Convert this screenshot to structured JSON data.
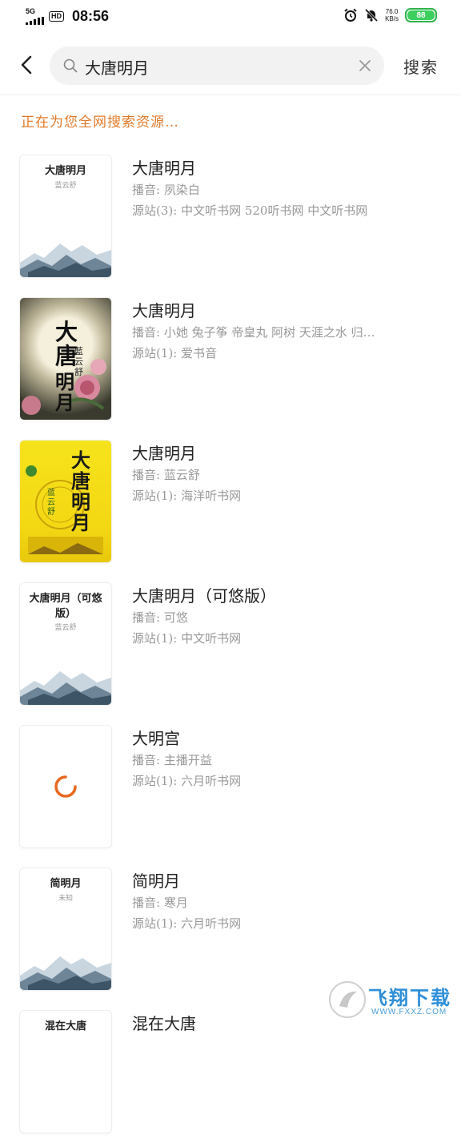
{
  "status_bar": {
    "network": "5G",
    "hd": "HD",
    "time": "08:56",
    "speed_value": "76.0",
    "speed_unit": "KB/s",
    "battery": "88"
  },
  "search": {
    "query": "大唐明月",
    "button": "搜索"
  },
  "status_text": "正在为您全网搜索资源…",
  "results": [
    {
      "title": "大唐明月",
      "narrator": "播音: 夙染白",
      "sources": "源站(3): 中文听书网  520听书网  中文听书网",
      "cover": {
        "type": "plain",
        "title": "大唐明月",
        "author": "蓝云舒"
      }
    },
    {
      "title": "大唐明月",
      "narrator": "播音: 小她  兔子筝  帝皇丸  阿树  天涯之水  归…",
      "sources": "源站(1): 爱书音",
      "cover": {
        "type": "moon",
        "title_a": "大唐",
        "title_b": "明月",
        "author": "藍云舒"
      }
    },
    {
      "title": "大唐明月",
      "narrator": "播音: 蓝云舒",
      "sources": "源站(1): 海洋听书网",
      "cover": {
        "type": "yellow",
        "title": "大唐明月",
        "subtitle": "蓝云舒"
      }
    },
    {
      "title": "大唐明月（可悠版）",
      "narrator": "播音: 可悠",
      "sources": "源站(1): 中文听书网",
      "cover": {
        "type": "plain",
        "title": "大唐明月（可悠版）",
        "author": "蓝云舒"
      }
    },
    {
      "title": "大明宫",
      "narrator": "播音: 主播开益",
      "sources": "源站(1): 六月听书网",
      "cover": {
        "type": "loading"
      }
    },
    {
      "title": "简明月",
      "narrator": "播音: 寒月",
      "sources": "源站(1): 六月听书网",
      "cover": {
        "type": "plain",
        "title": "简明月",
        "author": "未知"
      }
    },
    {
      "title": "混在大唐",
      "narrator": "",
      "sources": "",
      "cover": {
        "type": "plain",
        "title": "混在大唐",
        "author": ""
      }
    }
  ],
  "watermark": {
    "text": "飞翔下载",
    "url": "WWW.FXXZ.COM"
  },
  "colors": {
    "accent": "#e07a2a",
    "battery": "#3ccf5e",
    "meta": "#999999"
  }
}
